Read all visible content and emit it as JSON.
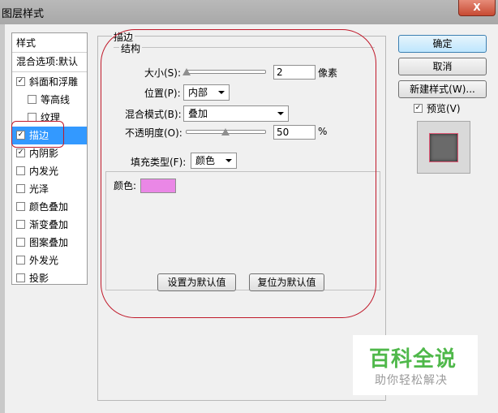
{
  "window": {
    "title": "图层样式",
    "close_label": "X"
  },
  "styles_list": {
    "header": "样式",
    "blend_options": "混合选项:默认",
    "items": [
      {
        "label": "斜面和浮雕",
        "checked": true
      },
      {
        "label": "等高线",
        "checked": false
      },
      {
        "label": "纹理",
        "checked": false
      },
      {
        "label": "描边",
        "checked": true
      },
      {
        "label": "内阴影",
        "checked": true
      },
      {
        "label": "内发光",
        "checked": false
      },
      {
        "label": "光泽",
        "checked": false
      },
      {
        "label": "颜色叠加",
        "checked": false
      },
      {
        "label": "渐变叠加",
        "checked": false
      },
      {
        "label": "图案叠加",
        "checked": false
      },
      {
        "label": "外发光",
        "checked": false
      },
      {
        "label": "投影",
        "checked": false
      }
    ]
  },
  "stroke": {
    "title": "描边",
    "structure": {
      "title": "结构",
      "size_label": "大小(S):",
      "size_value": "2",
      "size_unit": "像素",
      "position_label": "位置(P):",
      "position_value": "内部",
      "blend_label": "混合模式(B):",
      "blend_value": "叠加",
      "opacity_label": "不透明度(O):",
      "opacity_value": "50",
      "opacity_unit": "%"
    },
    "fill": {
      "type_label": "填充类型(F):",
      "type_value": "颜色",
      "color_label": "颜色:",
      "color": "#ea87e6"
    },
    "set_default": "设置为默认值",
    "reset_default": "复位为默认值"
  },
  "buttons": {
    "ok": "确定",
    "cancel": "取消",
    "new_style": "新建样式(W)..."
  },
  "preview": {
    "label": "预览(V)",
    "checked": true
  },
  "watermark": {
    "title": "百科全说",
    "subtitle": "助你轻松解决"
  },
  "annotation_color": "#c0192a"
}
